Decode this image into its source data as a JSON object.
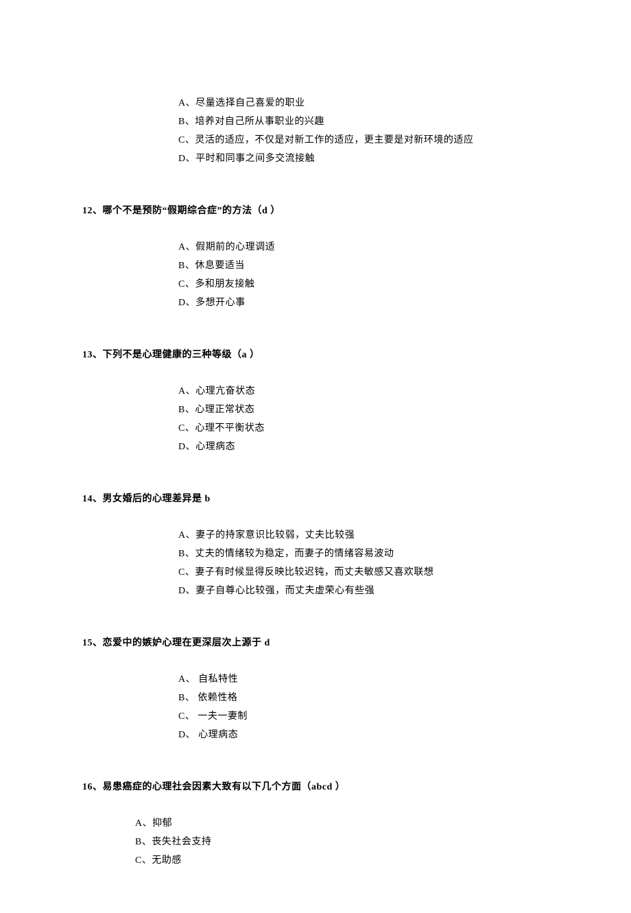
{
  "q11": {
    "opts": [
      "A、尽量选择自己喜爱的职业",
      "B、培养对自己所从事职业的兴趣",
      "C、灵活的适应，不仅是对新工作的适应，更主要是对新环境的适应",
      "D、平时和同事之间多交流接触"
    ]
  },
  "q12": {
    "stem": "12、哪个不是预防“假期综合症”的方法（d ）",
    "opts": [
      "A、假期前的心理调适",
      "B、休息要适当",
      "C、多和朋友接触",
      "D、多想开心事"
    ]
  },
  "q13": {
    "stem": "13、下列不是心理健康的三种等级（a ）",
    "opts": [
      "A、心理亢奋状态",
      "B、心理正常状态",
      "C、心理不平衡状态",
      "D、心理病态"
    ]
  },
  "q14": {
    "stem": "14、男女婚后的心理差异是 b",
    "opts": [
      "A、妻子的持家意识比较弱，丈夫比较强",
      "B、丈夫的情绪较为稳定，而妻子的情绪容易波动",
      "C、妻子有时候显得反映比较迟钝，而丈夫敏感又喜欢联想",
      "D、妻子自尊心比较强，而丈夫虚荣心有些强"
    ]
  },
  "q15": {
    "stem": "15、恋爱中的嫉妒心理在更深层次上源于 d",
    "opts": [
      "A、 自私特性",
      "B、 依赖性格",
      "C、 一夫一妻制",
      "D、 心理病态"
    ]
  },
  "q16": {
    "stem": "16、易患癌症的心理社会因素大致有以下几个方面（abcd ）",
    "opts": [
      "A、抑郁",
      "B、丧失社会支持",
      "C、无助感"
    ]
  }
}
